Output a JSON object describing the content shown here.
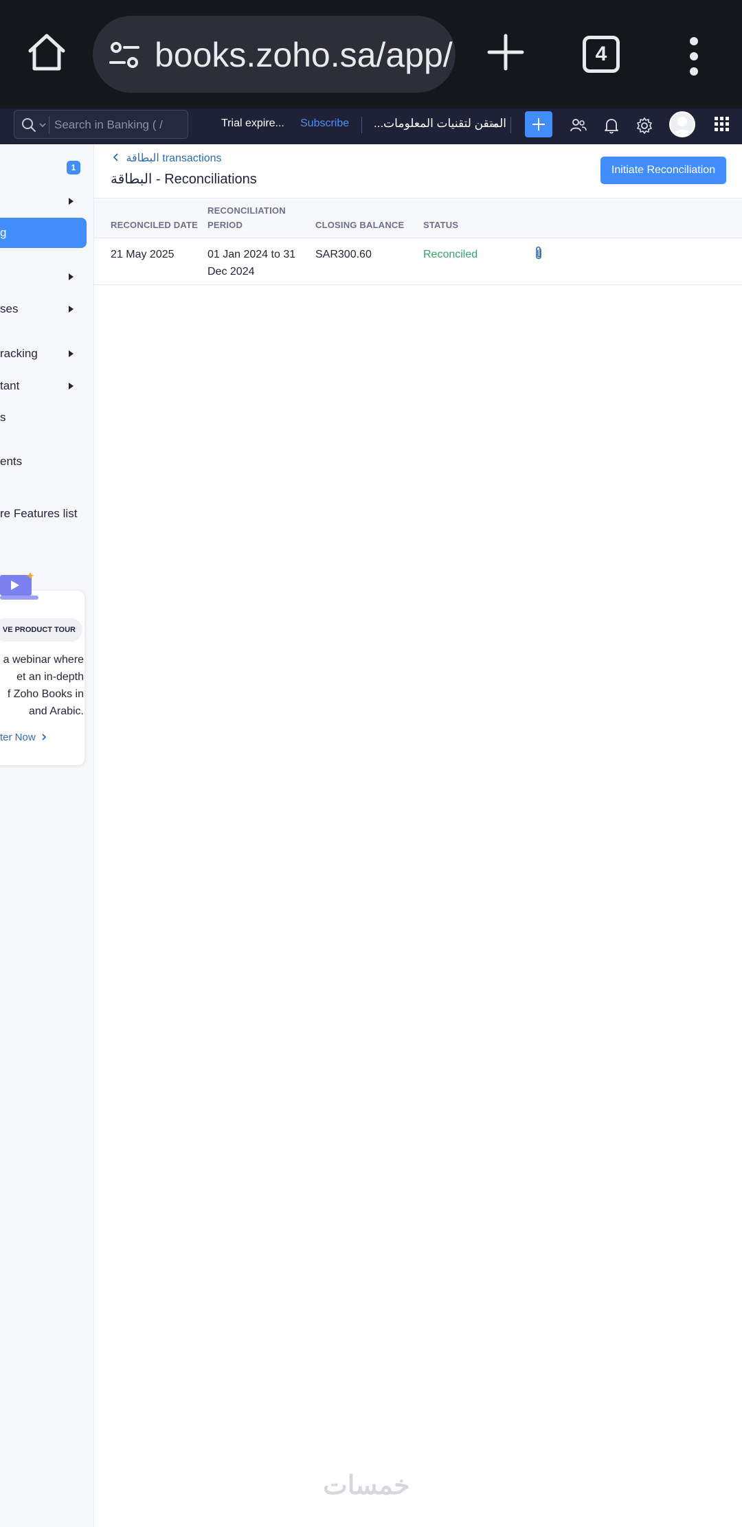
{
  "browser": {
    "url": "books.zoho.sa/app/",
    "tab_count": "4"
  },
  "header": {
    "search_placeholder": "Search in Banking ( /",
    "trial_text": "Trial expire...",
    "subscribe_label": "Subscribe",
    "org_name": "...المتقن لتقنيات المعلومات"
  },
  "sidebar": {
    "badge_count": "1",
    "active_label": "g",
    "items": [
      {
        "label": "ses"
      },
      {
        "label": "racking"
      },
      {
        "label": "tant"
      },
      {
        "label": "s"
      },
      {
        "label": "ents"
      },
      {
        "label": "re Features list"
      }
    ],
    "tour": {
      "pill": "VE PRODUCT TOUR",
      "lines": [
        "a webinar where",
        "et an in-depth",
        "f Zoho Books in",
        "and Arabic."
      ],
      "cta": "ter Now"
    }
  },
  "main": {
    "breadcrumb": "البطاقة transactions",
    "title": "البطاقة - Reconciliations",
    "initiate_label": "Initiate Reconciliation",
    "columns": [
      "RECONCILED DATE",
      "RECONCILIATION PERIOD",
      "CLOSING BALANCE",
      "STATUS"
    ],
    "rows": [
      {
        "reconciled_date": "21 May 2025",
        "period": "01 Jan 2024 to 31 Dec 2024",
        "closing_balance": "SAR300.60",
        "status": "Reconciled"
      }
    ]
  },
  "watermark": "خمسات",
  "colors": {
    "accent": "#408dfb",
    "header_bg": "#1f2236",
    "status_reconciled": "#2fa768",
    "link": "#2b6cb0"
  },
  "icons": [
    "home-icon",
    "tune-icon",
    "plus-icon",
    "more-vert-icon",
    "search-icon",
    "chevron-down-icon",
    "add-icon",
    "users-icon",
    "bell-icon",
    "gear-icon",
    "apps-grid-icon",
    "attachment-icon",
    "chevron-left-icon",
    "chevron-right-icon"
  ]
}
